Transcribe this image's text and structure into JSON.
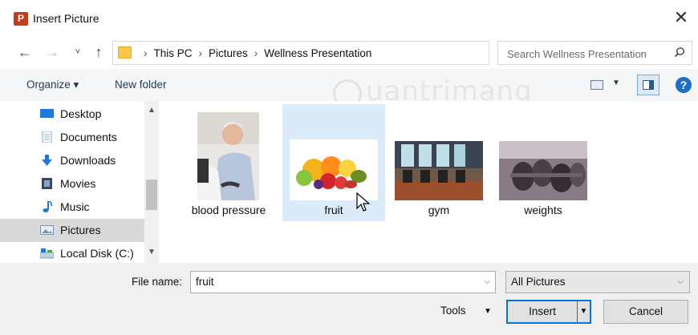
{
  "window": {
    "app_icon": "P",
    "title": "Insert Picture",
    "close_icon": "✕"
  },
  "navigation": {
    "back_icon": "←",
    "forward_icon": "→",
    "recent_icon": "˅",
    "up_icon": "↑",
    "breadcrumbs": [
      "This PC",
      "Pictures",
      "Wellness Presentation"
    ],
    "refresh_icon": "↻",
    "search_placeholder": "Search Wellness Presentation",
    "search_icon": "⌕"
  },
  "toolbar": {
    "organize_label": "Organize ▾",
    "new_folder_label": "New folder",
    "help_icon": "?",
    "watermark": "uantrimang"
  },
  "sidebar": {
    "items": [
      {
        "label": "Desktop",
        "icon": "desktop-icon",
        "color": "#1e78d7"
      },
      {
        "label": "Documents",
        "icon": "documents-icon",
        "color": "#7fa7d3"
      },
      {
        "label": "Downloads",
        "icon": "downloads-icon",
        "color": "#1e78d7"
      },
      {
        "label": "Movies",
        "icon": "movies-icon",
        "color": "#3a4a66"
      },
      {
        "label": "Music",
        "icon": "music-icon",
        "color": "#1e78d7"
      },
      {
        "label": "Pictures",
        "icon": "pictures-icon",
        "color": "#7d93ad"
      },
      {
        "label": "Local Disk (C:)",
        "icon": "local-disk-icon",
        "color": "#8a9fb8"
      }
    ],
    "selected_index": 5
  },
  "files": [
    {
      "name": "blood pressure"
    },
    {
      "name": "fruit"
    },
    {
      "name": "gym"
    },
    {
      "name": "weights"
    }
  ],
  "selected_file": "fruit",
  "footer": {
    "file_name_label": "File name:",
    "file_name_value": "fruit",
    "file_type_value": "All Pictures",
    "tools_label": "Tools",
    "insert_label": "Insert",
    "cancel_label": "Cancel"
  },
  "colors": {
    "accent": "#0078d7",
    "selection": "#dcebfa",
    "sidebar_selection": "#d9d9d9",
    "powerpoint": "#c43e1c"
  }
}
